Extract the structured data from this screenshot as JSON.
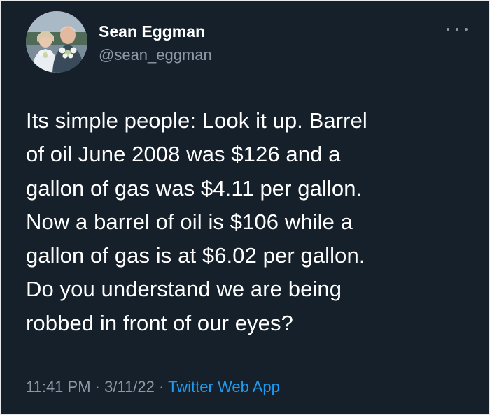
{
  "tweet": {
    "author_name": "Sean Eggman",
    "author_handle": "@sean_eggman",
    "text": "Its simple people:  Look it up.  Barrel\nof oil June 2008 was $126 and a\ngallon of gas was $4.11 per gallon.\nNow a barrel of oil is $106 while a\ngallon of gas is at $6.02 per gallon.\nDo you understand we are being\nrobbed in front of our eyes?",
    "time": "11:41 PM",
    "separator": "·",
    "date": "3/11/22",
    "source": "Twitter Web App"
  },
  "icons": {
    "more": "more-horizontal-icon",
    "avatar": "profile-photo"
  },
  "colors": {
    "background": "#15202b",
    "text": "#ffffff",
    "secondary": "#8b98a5",
    "link": "#1d9bf0"
  }
}
